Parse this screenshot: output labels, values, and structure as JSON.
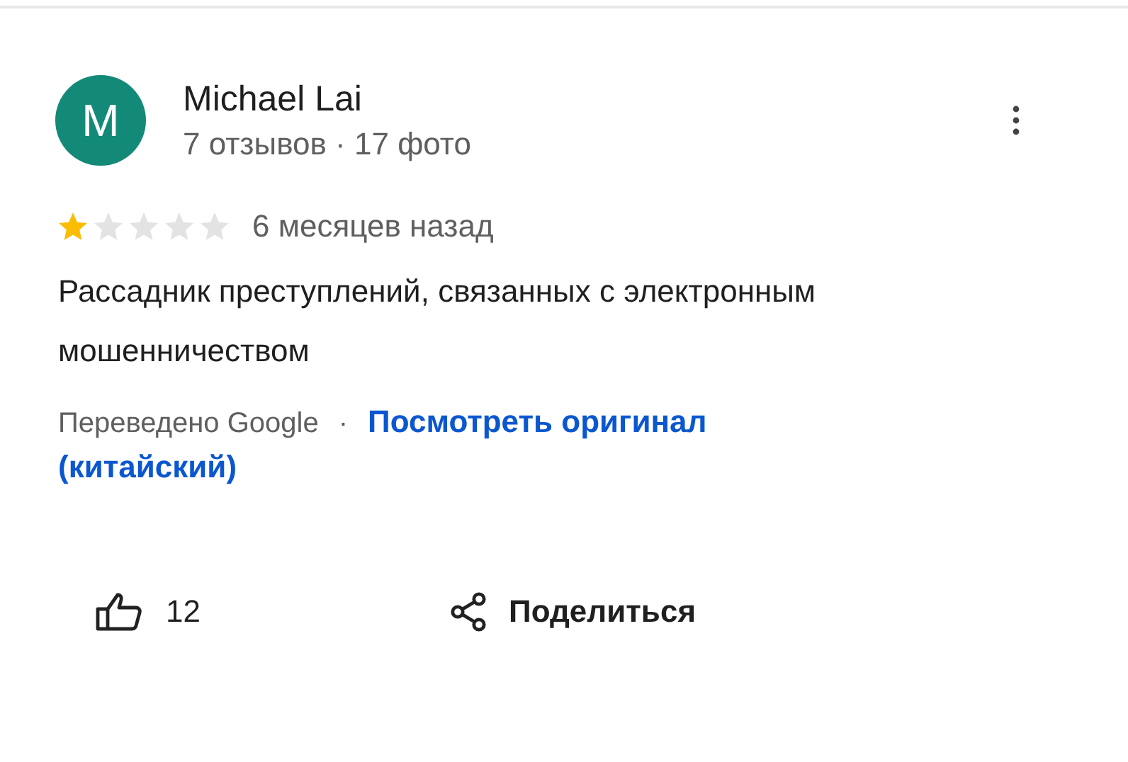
{
  "author": {
    "initial": "M",
    "name": "Michael Lai",
    "meta": "7 отзывов · 17 фото",
    "color": "#138a78"
  },
  "review": {
    "stars": 1,
    "time": "6 месяцев назад",
    "text": "Рассадник преступлений, связанных с электронным мошенничеством",
    "translated_by": "Переведено Google",
    "separator": "·",
    "original_link": [
      "Посмотреть оригинал",
      "(китайский)"
    ]
  },
  "actions": [
    {
      "kind": "like",
      "label": "12"
    },
    {
      "kind": "share",
      "label": "Поделиться"
    }
  ]
}
